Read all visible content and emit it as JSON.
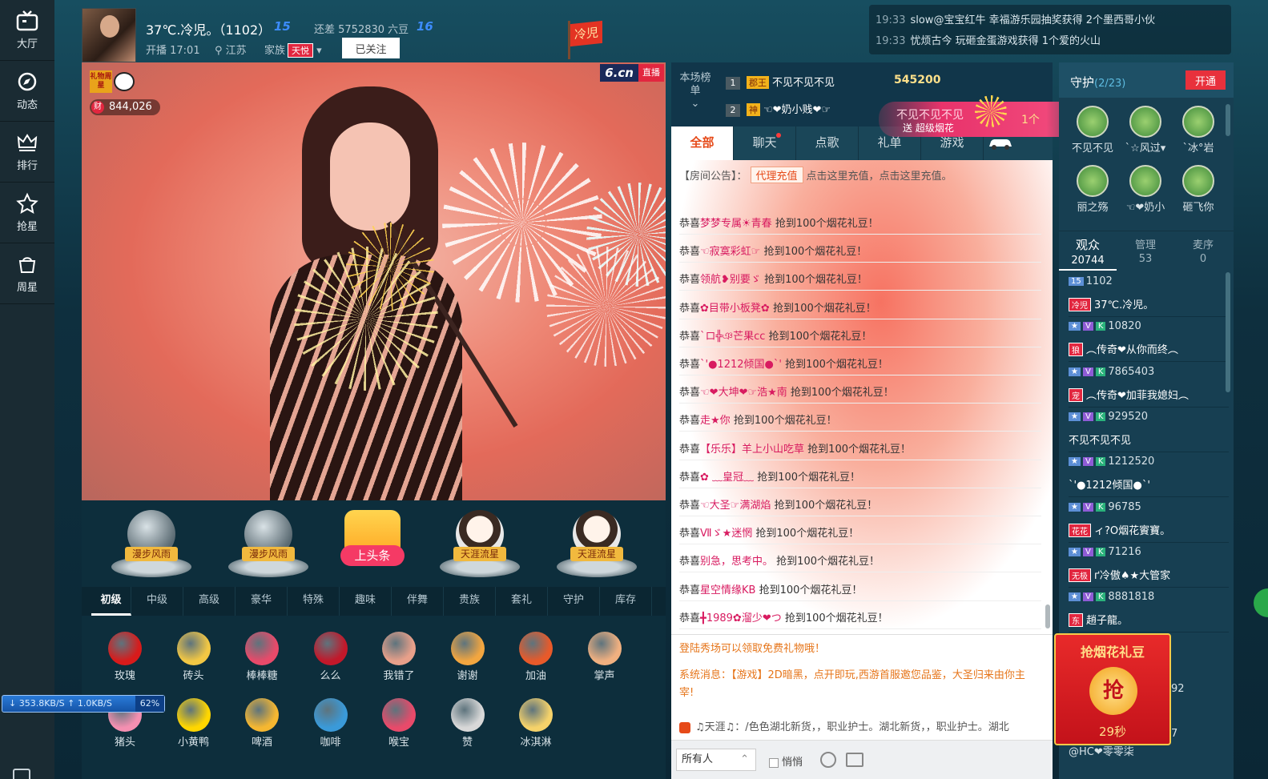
{
  "nav": {
    "items": [
      {
        "label": "大厅",
        "icon": "tv-icon"
      },
      {
        "label": "动态",
        "icon": "compass-icon"
      },
      {
        "label": "排行",
        "icon": "crown-icon"
      },
      {
        "label": "抢星",
        "icon": "star-icon"
      },
      {
        "label": "周星",
        "icon": "bag-icon"
      }
    ]
  },
  "host": {
    "name": "37℃.冷児。（1102）",
    "level_current": "15",
    "need_text": "还差 5752830 六豆",
    "level_next": "16",
    "start_time": "开播 17:01",
    "location": "江苏",
    "family_label": "家族",
    "family_tag": "天悦",
    "follow_label": "已关注",
    "flag_text": "冷児"
  },
  "ticker": [
    {
      "time": "19:33",
      "text": "slow@宝宝红牛 幸福游乐园抽奖获得 2个墨西哥小伙"
    },
    {
      "time": "19:33",
      "text": "忧烦古今 玩砸金蛋游戏获得 1个爱的火山"
    }
  ],
  "video": {
    "logo": "6.cn",
    "live_tag": "直播",
    "star_badge": "礼物周星",
    "wealth_icon": "财",
    "wealth": "844,026"
  },
  "gift_showcase": [
    {
      "label": "漫步风雨"
    },
    {
      "label": "漫步风雨"
    },
    {
      "label": "上头条"
    },
    {
      "label": "天涯流星"
    },
    {
      "label": "天涯流星"
    }
  ],
  "gift_tabs": [
    "初级",
    "中级",
    "高级",
    "豪华",
    "特殊",
    "趣味",
    "伴舞",
    "贵族",
    "套礼",
    "守护",
    "库存"
  ],
  "gifts": [
    {
      "name": "玫瑰",
      "color": "#d81b1b"
    },
    {
      "name": "砖头",
      "color": "#f2c744"
    },
    {
      "name": "棒棒糖",
      "color": "#e84a6a"
    },
    {
      "name": "么么",
      "color": "#c2182a"
    },
    {
      "name": "我错了",
      "color": "#e8a08a"
    },
    {
      "name": "谢谢",
      "color": "#f2a640"
    },
    {
      "name": "加油",
      "color": "#e85a2a"
    },
    {
      "name": "掌声",
      "color": "#f0b080"
    },
    {
      "name": "猪头",
      "color": "#f48fb1"
    },
    {
      "name": "小黄鸭",
      "color": "#ffd600"
    },
    {
      "name": "啤酒",
      "color": "#f5b731"
    },
    {
      "name": "咖啡",
      "color": "#3a9ad9"
    },
    {
      "name": "喉宝",
      "color": "#e84a6a"
    },
    {
      "name": "赞",
      "color": "#d8d8d8"
    },
    {
      "name": "冰淇淋",
      "color": "#f5d26a"
    }
  ],
  "speed": {
    "down": "353.8KB/S",
    "up": "1.0KB/S",
    "pct": "62%"
  },
  "rank": {
    "label": "本场榜单",
    "rows": [
      {
        "no": "1",
        "tag": "郡王",
        "name": "不见不见不见",
        "value": "545200"
      },
      {
        "no": "2",
        "tag": "神",
        "name": "☜❤奶小贱❤☞",
        "value": ""
      }
    ]
  },
  "banner": {
    "line1": "不见不见不见",
    "line2": "送 超级烟花",
    "count": "1个"
  },
  "chat_tabs": [
    "全部",
    "聊天",
    "点歌",
    "礼单",
    "游戏"
  ],
  "notice": {
    "prefix": "【房间公告】：",
    "button": "代理充值",
    "text": "点击这里充值，点击这里充值。"
  },
  "chat": [
    {
      "user": "梦梦专属☀青春",
      "text": "抢到100个烟花礼豆！"
    },
    {
      "user": "☜寂寞彩虹☞",
      "text": "抢到100个烟花礼豆！"
    },
    {
      "user": "领航❥别要ゞ",
      "text": "抢到100个烟花礼豆！"
    },
    {
      "user": "✿目带小板凳✿",
      "text": "抢到100个烟花礼豆！"
    },
    {
      "user": "`ロ╬ঞ芒果cc",
      "text": "抢到100个烟花礼豆！"
    },
    {
      "user": "`'●1212倾国●`'",
      "text": "抢到100个烟花礼豆！"
    },
    {
      "user": "☜❤大坤❤☞浩★南",
      "text": "抢到100个烟花礼豆！"
    },
    {
      "user": "走★你",
      "text": "抢到100个烟花礼豆！"
    },
    {
      "user": "【乐乐】羊上小山吃草",
      "text": "抢到100个烟花礼豆！"
    },
    {
      "user": "✿ ﹏皇冠﹏",
      "text": "抢到100个烟花礼豆！"
    },
    {
      "user": "☜大圣☞满湖焰",
      "text": "抢到100个烟花礼豆！"
    },
    {
      "user": "Ⅶゞ★迷惘",
      "text": "抢到100个烟花礼豆！"
    },
    {
      "user": "别急，思考中。",
      "text": "抢到100个烟花礼豆！"
    },
    {
      "user": "星空情缘KB",
      "text": "抢到100个烟花礼豆！"
    },
    {
      "user": "╋1989✿溜少❤つ",
      "text": "抢到100个烟花礼豆！"
    }
  ],
  "chat_prefix": "恭喜",
  "system": {
    "free_gift": "登陆秀场可以领取免费礼物哦！",
    "message": "系统消息：【游戏】2D暗黑，点开即玩,西游首服邀您品鉴，大圣归来由你主宰!",
    "broadcast": "♫天涯♫：/色色湖北新货，，职业护士。湖北新货，，职业护士。湖北"
  },
  "input": {
    "to": "所有人",
    "whisper": "悄悄"
  },
  "guard": {
    "title": "守护",
    "count": "(2/23)",
    "open_label": "开通",
    "members": [
      "不见不见",
      "ˋ☆风过▾",
      "ˋ冰°岩",
      "丽之殇",
      "☜❤奶小",
      "砸飞你"
    ]
  },
  "audience_tabs": [
    {
      "label": "观众",
      "count": "20744"
    },
    {
      "label": "管理",
      "count": "53"
    },
    {
      "label": "麦序",
      "count": "0"
    }
  ],
  "audience": [
    {
      "tag": "15",
      "id": "1102",
      "name": "37℃.冷児。",
      "nametag": "冷児"
    },
    {
      "tag": "",
      "id": "10820",
      "name": "︵传奇❤从你而终︵",
      "nametag": "狼"
    },
    {
      "tag": "",
      "id": "7865403",
      "name": "︵传奇❤加菲我媳妇︵",
      "nametag": "宠"
    },
    {
      "tag": "",
      "id": "929520",
      "name": "不见不见不见",
      "nametag": ""
    },
    {
      "tag": "",
      "id": "1212520",
      "name": "`'●1212倾国●`'",
      "nametag": ""
    },
    {
      "tag": "",
      "id": "96785",
      "name": "ィ?O烟花賨寶。",
      "nametag": "花花"
    },
    {
      "tag": "",
      "id": "71216",
      "name": "ґ冷傲♠★大管家",
      "nametag": "无极"
    },
    {
      "tag": "",
      "id": "8881818",
      "name": "趙子龍。",
      "nametag": "东"
    }
  ],
  "audience_partial": [
    {
      "text": "92"
    },
    {
      "text": "7"
    },
    {
      "text": "@HC❤零零柒"
    }
  ],
  "envelope": {
    "title": "抢烟花礼豆",
    "button": "抢",
    "timer": "29秒"
  }
}
